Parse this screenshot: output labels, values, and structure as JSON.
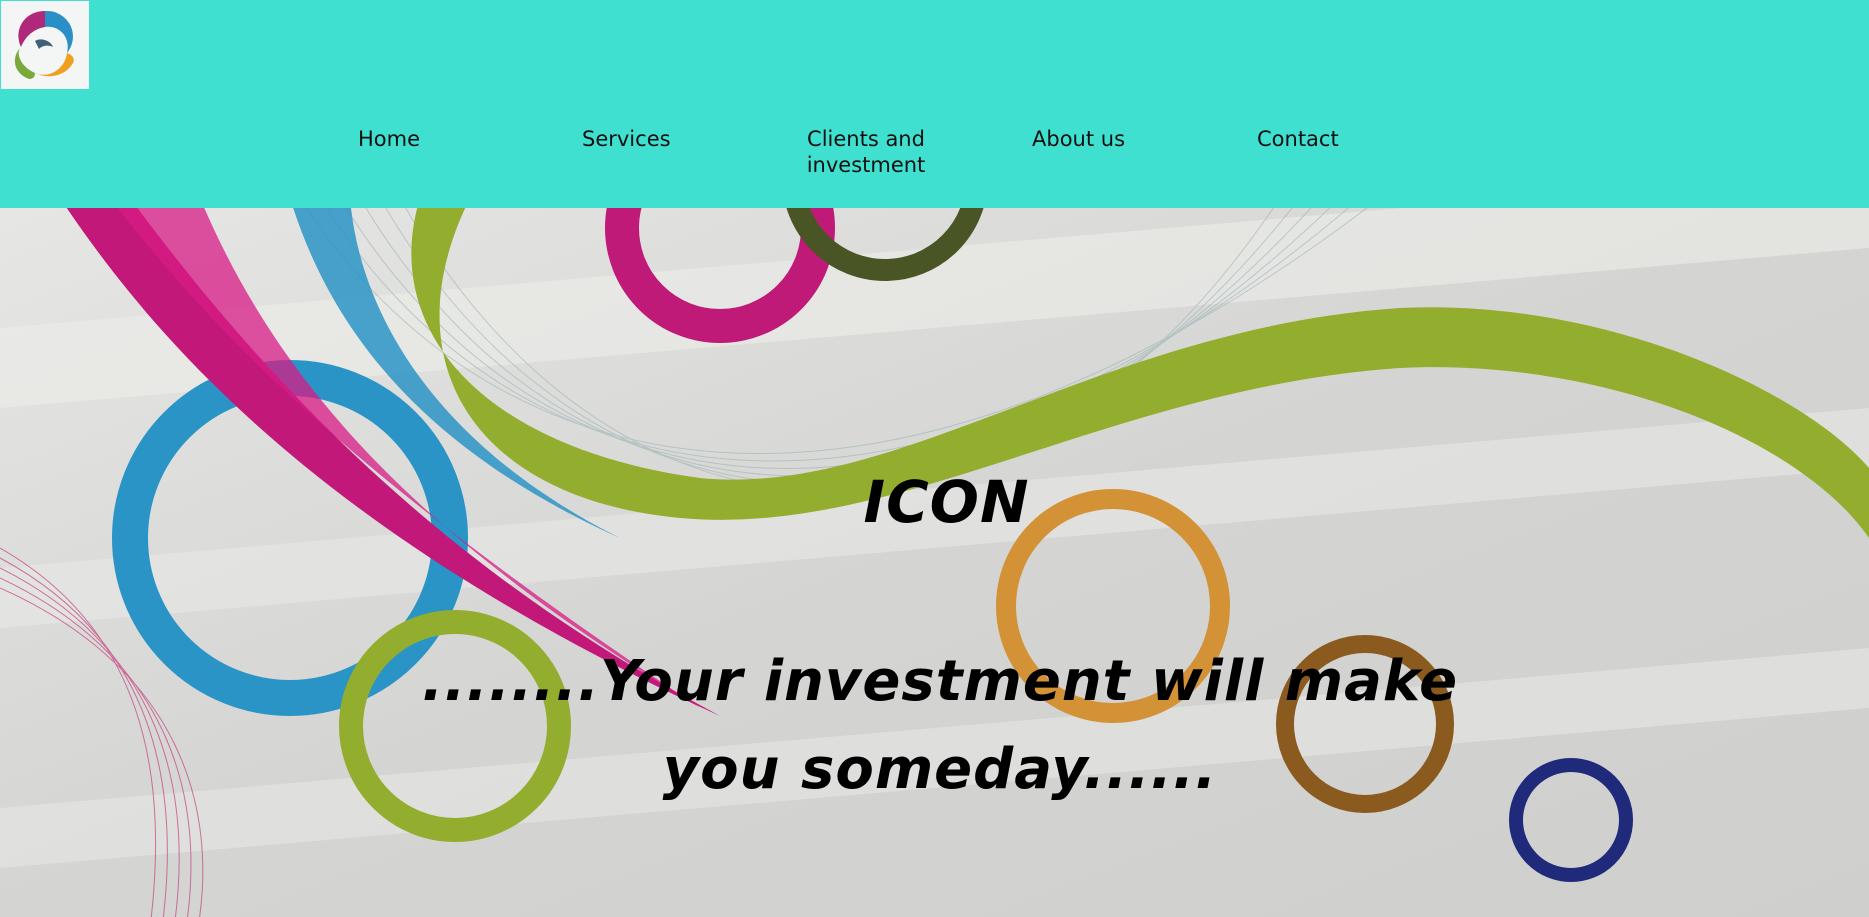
{
  "header": {
    "logo_icon": "swirl-logo-icon",
    "background_color": "#40e0d0"
  },
  "nav": {
    "items": [
      {
        "label": "Home"
      },
      {
        "label": "Services"
      },
      {
        "label": "Clients and investment"
      },
      {
        "label": "About us"
      },
      {
        "label": "Contact"
      }
    ]
  },
  "hero": {
    "title": "ICON",
    "tagline": "........Your investment will make you someday......",
    "background": "abstract-ribbons-and-rings-image"
  }
}
